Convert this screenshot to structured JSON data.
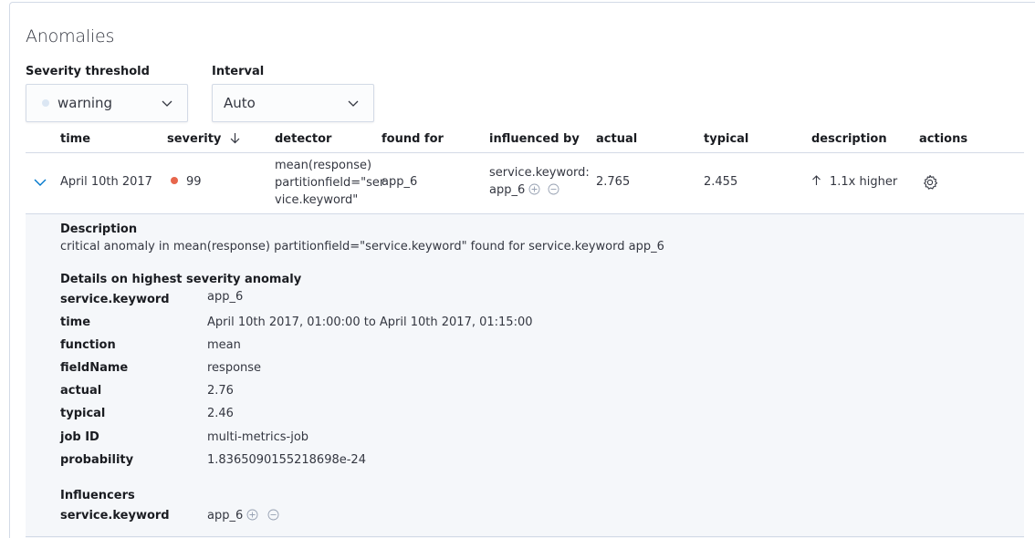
{
  "title": "Anomalies",
  "controls": {
    "severity_label": "Severity threshold",
    "severity_value": "warning",
    "interval_label": "Interval",
    "interval_value": "Auto"
  },
  "table": {
    "headers": {
      "time": "time",
      "severity": "severity",
      "detector": "detector",
      "found_for": "found for",
      "influenced_by": "influenced by",
      "actual": "actual",
      "typical": "typical",
      "description": "description",
      "actions": "actions"
    },
    "row": {
      "time": "April 10th 2017",
      "severity": "99",
      "detector_line1": "mean(response)",
      "detector_line2": "partitionfield=\"ser",
      "detector_line3": "vice.keyword\"",
      "found_for": "app_6",
      "influencer_line1": "service.keyword:",
      "influencer_value": "app_6",
      "actual": "2.765",
      "typical": "2.455",
      "description": "1.1x higher"
    }
  },
  "details": {
    "description_heading": "Description",
    "description_text": "critical anomaly in mean(response) partitionfield=\"service.keyword\" found for service.keyword app_6",
    "highest_heading": "Details on highest severity anomaly",
    "fields": [
      {
        "label": "service.keyword",
        "value": "app_6"
      },
      {
        "label": "time",
        "value": "April 10th 2017, 01:00:00 to April 10th 2017, 01:15:00"
      },
      {
        "label": "function",
        "value": "mean"
      },
      {
        "label": "fieldName",
        "value": "response"
      },
      {
        "label": "actual",
        "value": "2.76"
      },
      {
        "label": "typical",
        "value": "2.46"
      },
      {
        "label": "job ID",
        "value": "multi-metrics-job"
      },
      {
        "label": "probability",
        "value": "1.8365090155218698e-24"
      }
    ],
    "influencers_heading": "Influencers",
    "influencer": {
      "label": "service.keyword",
      "value": "app_6"
    }
  },
  "colors": {
    "severity_critical": "#e7664c",
    "severity_warning": "#dbe6f3",
    "expanded_bg": "#f5f7fa",
    "border": "#d3dae6"
  },
  "icons": {
    "expand": "chevron-down-icon",
    "sort": "arrow-down-icon",
    "increase": "arrow-up-icon",
    "actions": "gear-icon",
    "filter_in": "plus-in-circle-icon",
    "filter_out": "minus-in-circle-icon"
  }
}
